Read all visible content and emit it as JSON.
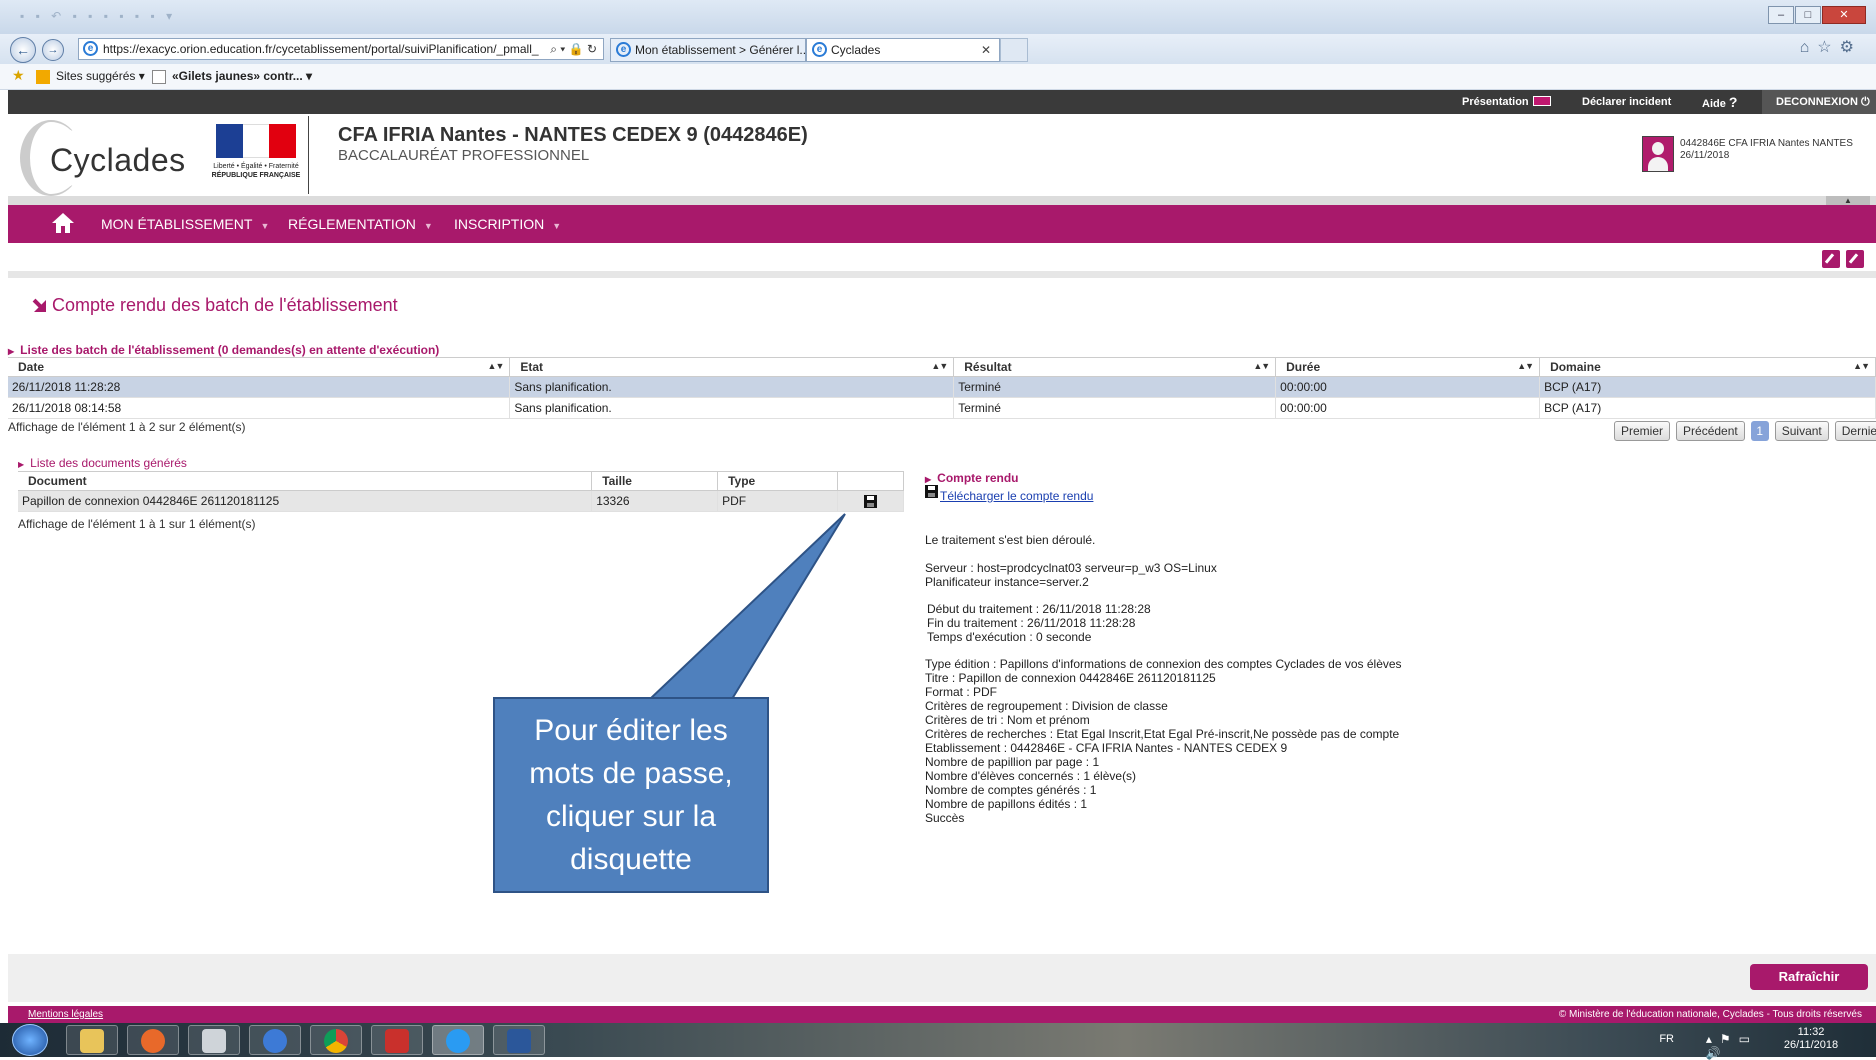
{
  "browser": {
    "url": "https://exacyc.orion.education.fr/cycetablissement/portal/suiviPlanification/_pmall_",
    "tabs": [
      {
        "label": "Mon établissement > Générer l..."
      },
      {
        "label": "Cyclades"
      }
    ],
    "favorites": {
      "suggested": "Sites suggérés",
      "link": "«Gilets jaunes» contr..."
    }
  },
  "topbar": {
    "presentation": "Présentation",
    "incident": "Déclarer incident",
    "help": "Aide",
    "help_icon": "?",
    "logout": "DECONNEXION",
    "logout_icon": "⏻"
  },
  "header": {
    "logo": "Cyclades",
    "republic_motto": "Liberté • Égalité • Fraternité",
    "republic": "RÉPUBLIQUE FRANÇAISE",
    "etab_name": "CFA IFRIA Nantes - NANTES CEDEX 9 (0442846E)",
    "subtitle": "BACCALAURÉAT PROFESSIONNEL",
    "user_line1": "0442846E CFA IFRIA Nantes NANTES",
    "user_line2": "26/11/2018"
  },
  "menu": {
    "items": [
      {
        "label": "MON ÉTABLISSEMENT"
      },
      {
        "label": "RÉGLEMENTATION"
      },
      {
        "label": "INSCRIPTION"
      }
    ]
  },
  "page": {
    "title": "Compte rendu des batch de l'établissement"
  },
  "batch": {
    "section_title": "Liste des batch de l'établissement (0 demandes(s) en attente d'exécution)",
    "columns": [
      "Date",
      "Etat",
      "Résultat",
      "Durée",
      "Domaine"
    ],
    "rows": [
      [
        "26/11/2018 11:28:28",
        "Sans planification.",
        "Terminé",
        "00:00:00",
        "BCP (A17)"
      ],
      [
        "26/11/2018 08:14:58",
        "Sans planification.",
        "Terminé",
        "00:00:00",
        "BCP (A17)"
      ]
    ],
    "info": "Affichage de l'élément 1 à 2 sur 2 élément(s)",
    "pager": {
      "first": "Premier",
      "prev": "Précédent",
      "page": "1",
      "next": "Suivant",
      "last": "Dernier"
    }
  },
  "documents": {
    "section_title": "Liste des documents générés",
    "columns": [
      "Document",
      "Taille",
      "Type"
    ],
    "rows": [
      [
        "Papillon de connexion 0442846E 261120181125",
        "13326",
        "PDF"
      ]
    ],
    "info": "Affichage de l'élément 1 à 1 sur 1 élément(s)"
  },
  "compte_rendu": {
    "section_title": "Compte rendu",
    "download": "Télécharger le compte rendu",
    "lines": [
      "Le traitement s'est bien déroulé.",
      "Serveur : host=prodcyclnat03 serveur=p_w3 OS=Linux",
      "Planificateur instance=server.2",
      "Début du traitement : 26/11/2018 11:28:28",
      "Fin du traitement : 26/11/2018 11:28:28",
      "Temps d'exécution : 0 seconde",
      "Type édition : Papillons d'informations de connexion des comptes Cyclades de vos élèves",
      "Titre : Papillon de connexion 0442846E 261120181125",
      "Format : PDF",
      "Critères de regroupement : Division de classe",
      "Critères de tri : Nom et prénom",
      "Critères de recherches : Etat Egal Inscrit,Etat Egal Pré-inscrit,Ne possède pas de compte",
      "Etablissement : 0442846E - CFA IFRIA Nantes - NANTES CEDEX 9",
      "Nombre de papillion par page : 1",
      "Nombre d'élèves concernés : 1 élève(s)",
      "Nombre de comptes générés : 1",
      "Nombre de papillons édités : 1",
      "Succès"
    ]
  },
  "callout": {
    "line1": "Pour éditer les",
    "line2": "mots de passe,",
    "line3": "cliquer sur la",
    "line4": "disquette"
  },
  "actions": {
    "refresh": "Rafraîchir"
  },
  "footer": {
    "legal": "Mentions légales",
    "copyright": "© Ministère de l'éducation nationale, Cyclades - Tous droits réservés"
  },
  "taskbar": {
    "lang": "FR",
    "time": "11:32",
    "date": "26/11/2018"
  },
  "colors": {
    "brand": "#a8196b",
    "selected_row": "#c8d3e4",
    "callout": "#4f80bd"
  }
}
